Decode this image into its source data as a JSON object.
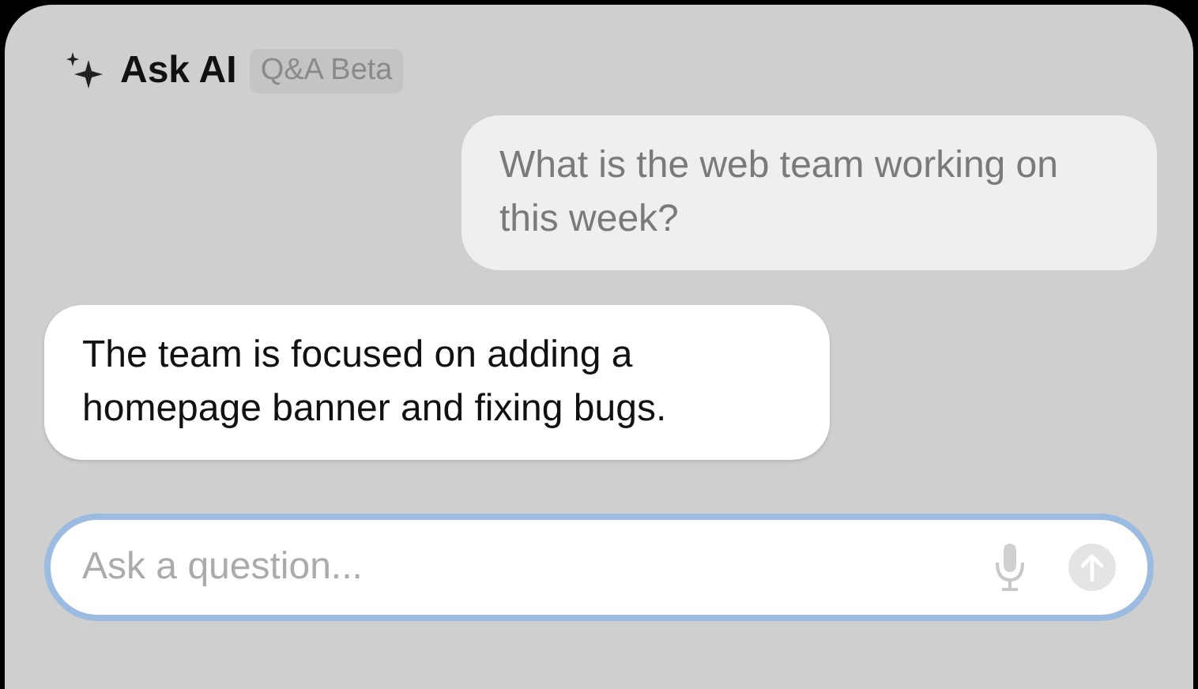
{
  "header": {
    "title": "Ask AI",
    "badge": "Q&A Beta"
  },
  "messages": [
    {
      "kind": "user",
      "text": "What is the web team working on this week?"
    },
    {
      "kind": "assistant",
      "text": "The team is focused on adding a homepage banner and fixing bugs."
    }
  ],
  "input": {
    "placeholder": "Ask a question..."
  }
}
